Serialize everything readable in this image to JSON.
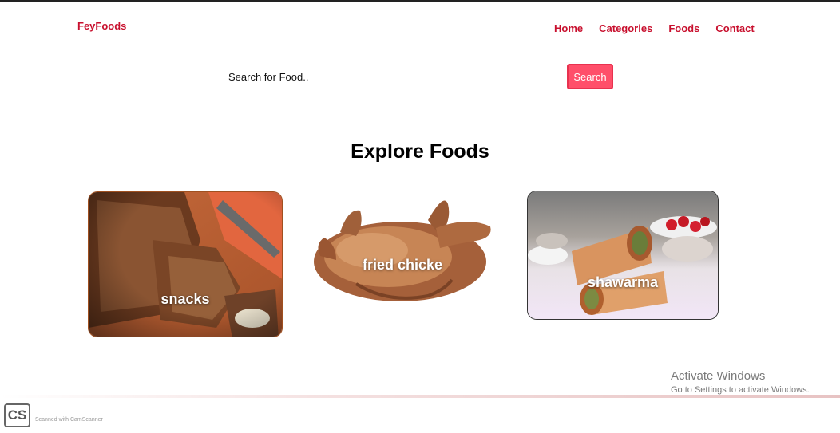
{
  "header": {
    "logo": "FeyFoods",
    "nav": [
      {
        "label": "Home"
      },
      {
        "label": "Categories"
      },
      {
        "label": "Foods"
      },
      {
        "label": "Contact"
      }
    ]
  },
  "search": {
    "placeholder": "Search for Food..",
    "button_label": "Search"
  },
  "main": {
    "heading": "Explore Foods",
    "cards": [
      {
        "label": "snacks"
      },
      {
        "label": "fried chicke"
      },
      {
        "label": "shawarma"
      }
    ]
  },
  "overlay": {
    "windows_title": "Activate Windows",
    "windows_sub": "Go to Settings to activate Windows.",
    "scanner_logo": "CS",
    "scanner_text": "Scanned with CamScanner"
  },
  "colors": {
    "brand": "#c8102e",
    "button": "#ff4f6a"
  }
}
